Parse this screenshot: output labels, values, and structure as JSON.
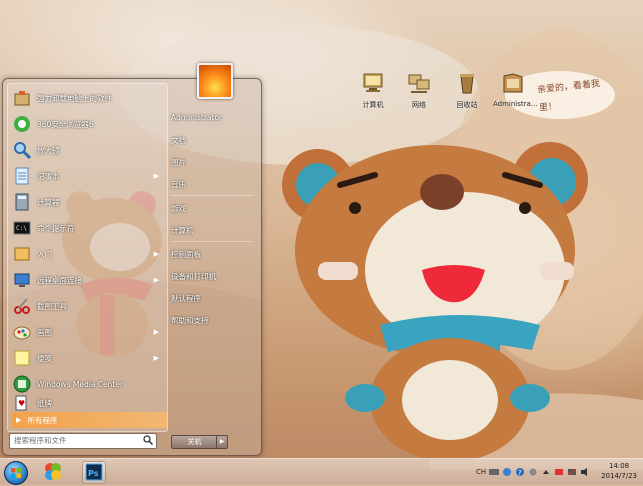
{
  "start_menu": {
    "programs": [
      {
        "label": "强力卸载电脑上的软件",
        "icon": "uninstall-icon"
      },
      {
        "label": "360安全浏览器6",
        "icon": "browser-360-icon"
      },
      {
        "label": "放大镜",
        "icon": "magnifier-icon"
      },
      {
        "label": "记事本",
        "icon": "notepad-icon"
      },
      {
        "label": "计算器",
        "icon": "calculator-icon"
      },
      {
        "label": "命令提示符",
        "icon": "cmd-icon"
      },
      {
        "label": "入门",
        "icon": "getting-started-icon"
      },
      {
        "label": "远程桌面连接",
        "icon": "remote-desktop-icon"
      },
      {
        "label": "截图工具",
        "icon": "snipping-tool-icon"
      },
      {
        "label": "画图",
        "icon": "paint-icon"
      },
      {
        "label": "便笺",
        "icon": "sticky-notes-icon"
      },
      {
        "label": "Windows Media Center",
        "icon": "media-center-icon"
      },
      {
        "label": "纸牌",
        "icon": "solitaire-icon"
      }
    ],
    "all_programs": "所有程序",
    "search_placeholder": "搜索程序和文件",
    "right": {
      "user": "Administrator",
      "documents": "文档",
      "pictures": "图片",
      "music": "音乐",
      "games": "游戏",
      "computer": "计算机",
      "control_panel": "控制面板",
      "devices_printers": "设备和打印机",
      "default_programs": "默认程序",
      "help_support": "帮助和支持"
    },
    "shutdown": "关机"
  },
  "desktop": {
    "icons": [
      {
        "label": "计算机",
        "icon": "computer-icon"
      },
      {
        "label": "网络",
        "icon": "network-icon"
      },
      {
        "label": "回收站",
        "icon": "recycle-bin-icon"
      },
      {
        "label": "Administra...",
        "icon": "user-folder-icon"
      }
    ],
    "wallpaper_card": "亲爱的，看着我里！"
  },
  "taskbar": {
    "tray_lang": "CH",
    "time": "14:08",
    "date": "2014/7/23"
  }
}
